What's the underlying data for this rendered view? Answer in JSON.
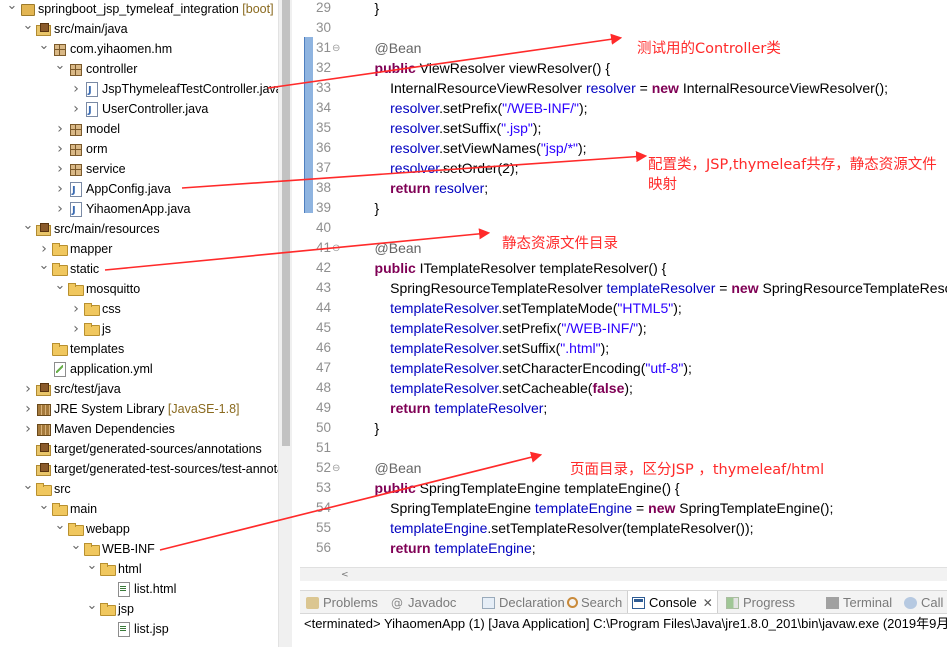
{
  "explorer": {
    "items": [
      {
        "label": "springboot_jsp_tymeleaf_integration",
        "suffix": " [boot]",
        "icon": "project-icon",
        "arrow": "down",
        "depth": 0
      },
      {
        "label": "src/main/java",
        "icon": "source-folder-icon",
        "arrow": "down",
        "depth": 1
      },
      {
        "label": "com.yihaomen.hm",
        "icon": "package-icon",
        "arrow": "down",
        "depth": 2
      },
      {
        "label": "controller",
        "icon": "package-icon",
        "arrow": "down",
        "depth": 3
      },
      {
        "label": "JspThymeleafTestController.java",
        "icon": "java-file-icon",
        "arrow": "right",
        "depth": 4
      },
      {
        "label": "UserController.java",
        "icon": "java-file-icon",
        "arrow": "right",
        "depth": 4
      },
      {
        "label": "model",
        "icon": "package-icon",
        "arrow": "right",
        "depth": 3
      },
      {
        "label": "orm",
        "icon": "package-icon",
        "arrow": "right",
        "depth": 3
      },
      {
        "label": "service",
        "icon": "package-icon",
        "arrow": "right",
        "depth": 3
      },
      {
        "label": "AppConfig.java",
        "icon": "java-file-icon",
        "arrow": "right",
        "depth": 3
      },
      {
        "label": "YihaomenApp.java",
        "icon": "java-file-icon",
        "arrow": "right",
        "depth": 3
      },
      {
        "label": "src/main/resources",
        "icon": "source-folder-icon",
        "arrow": "down",
        "depth": 1
      },
      {
        "label": "mapper",
        "icon": "folder-icon",
        "arrow": "right",
        "depth": 2
      },
      {
        "label": "static",
        "icon": "folder-icon",
        "arrow": "down",
        "depth": 2
      },
      {
        "label": "mosquitto",
        "icon": "folder-icon",
        "arrow": "down",
        "depth": 3
      },
      {
        "label": "css",
        "icon": "folder-icon",
        "arrow": "right",
        "depth": 4
      },
      {
        "label": "js",
        "icon": "folder-icon",
        "arrow": "right",
        "depth": 4
      },
      {
        "label": "templates",
        "icon": "folder-icon",
        "arrow": "none",
        "depth": 2
      },
      {
        "label": "application.yml",
        "icon": "yml-file-icon",
        "arrow": "none",
        "depth": 2
      },
      {
        "label": "src/test/java",
        "icon": "source-folder-icon",
        "arrow": "right",
        "depth": 1
      },
      {
        "label": "JRE System Library",
        "suffix": " [JavaSE-1.8]",
        "icon": "library-icon",
        "arrow": "right",
        "depth": 1
      },
      {
        "label": "Maven Dependencies",
        "icon": "library-icon",
        "arrow": "right",
        "depth": 1
      },
      {
        "label": "target/generated-sources/annotations",
        "icon": "source-folder-icon",
        "arrow": "none",
        "depth": 1
      },
      {
        "label": "target/generated-test-sources/test-annotations",
        "icon": "source-folder-icon",
        "arrow": "none",
        "depth": 1
      },
      {
        "label": "src",
        "icon": "folder-icon",
        "arrow": "down",
        "depth": 1
      },
      {
        "label": "main",
        "icon": "folder-icon",
        "arrow": "down",
        "depth": 2
      },
      {
        "label": "webapp",
        "icon": "folder-icon",
        "arrow": "down",
        "depth": 3
      },
      {
        "label": "WEB-INF",
        "icon": "folder-icon",
        "arrow": "down",
        "depth": 4
      },
      {
        "label": "html",
        "icon": "folder-icon",
        "arrow": "down",
        "depth": 5
      },
      {
        "label": "list.html",
        "icon": "html-file-icon",
        "arrow": "none",
        "depth": 6
      },
      {
        "label": "jsp",
        "icon": "folder-icon",
        "arrow": "down",
        "depth": 5
      },
      {
        "label": "list.jsp",
        "icon": "html-file-icon",
        "arrow": "none",
        "depth": 6
      }
    ]
  },
  "editor": {
    "lines": [
      {
        "n": "29",
        "fold": "",
        "t": [
          [
            "p",
            "    }"
          ]
        ]
      },
      {
        "n": "30",
        "fold": "",
        "t": []
      },
      {
        "n": "31",
        "fold": "⊖",
        "t": [
          [
            "a",
            "    @Bean"
          ]
        ]
      },
      {
        "n": "32",
        "fold": "",
        "t": [
          [
            "k",
            "    public "
          ],
          [
            "p",
            "ViewResolver viewResolver() {"
          ]
        ]
      },
      {
        "n": "33",
        "fold": "",
        "t": [
          [
            "p",
            "        InternalResourceViewResolver "
          ],
          [
            "v",
            "resolver"
          ],
          [
            "p",
            " = "
          ],
          [
            "k",
            "new "
          ],
          [
            "p",
            "InternalResourceViewResolver();"
          ]
        ]
      },
      {
        "n": "34",
        "fold": "",
        "t": [
          [
            "v",
            "        resolver"
          ],
          [
            "p",
            ".setPrefix("
          ],
          [
            "s",
            "\"/WEB-INF/\""
          ],
          [
            "p",
            ");"
          ]
        ]
      },
      {
        "n": "35",
        "fold": "",
        "t": [
          [
            "v",
            "        resolver"
          ],
          [
            "p",
            ".setSuffix("
          ],
          [
            "s",
            "\".jsp\""
          ],
          [
            "p",
            ");"
          ]
        ]
      },
      {
        "n": "36",
        "fold": "",
        "t": [
          [
            "v",
            "        resolver"
          ],
          [
            "p",
            ".setViewNames("
          ],
          [
            "s",
            "\"jsp/*\""
          ],
          [
            "p",
            ");"
          ]
        ]
      },
      {
        "n": "37",
        "fold": "",
        "t": [
          [
            "v",
            "        resolver"
          ],
          [
            "p",
            ".setOrder(2);"
          ]
        ]
      },
      {
        "n": "38",
        "fold": "",
        "t": [
          [
            "k",
            "        return "
          ],
          [
            "v",
            "resolver"
          ],
          [
            "p",
            ";"
          ]
        ]
      },
      {
        "n": "39",
        "fold": "",
        "t": [
          [
            "p",
            "    }"
          ]
        ]
      },
      {
        "n": "40",
        "fold": "",
        "t": []
      },
      {
        "n": "41",
        "fold": "⊖",
        "t": [
          [
            "a",
            "    @Bean"
          ]
        ]
      },
      {
        "n": "42",
        "fold": "",
        "t": [
          [
            "k",
            "    public "
          ],
          [
            "p",
            "ITemplateResolver templateResolver() {"
          ]
        ]
      },
      {
        "n": "43",
        "fold": "",
        "t": [
          [
            "p",
            "        SpringResourceTemplateResolver "
          ],
          [
            "v",
            "templateResolver"
          ],
          [
            "p",
            " = "
          ],
          [
            "k",
            "new "
          ],
          [
            "p",
            "SpringResourceTemplateResolver();"
          ]
        ]
      },
      {
        "n": "44",
        "fold": "",
        "t": [
          [
            "v",
            "        templateResolver"
          ],
          [
            "p",
            ".setTemplateMode("
          ],
          [
            "s",
            "\"HTML5\""
          ],
          [
            "p",
            ");"
          ]
        ]
      },
      {
        "n": "45",
        "fold": "",
        "t": [
          [
            "v",
            "        templateResolver"
          ],
          [
            "p",
            ".setPrefix("
          ],
          [
            "s",
            "\"/WEB-INF/\""
          ],
          [
            "p",
            ");"
          ]
        ]
      },
      {
        "n": "46",
        "fold": "",
        "t": [
          [
            "v",
            "        templateResolver"
          ],
          [
            "p",
            ".setSuffix("
          ],
          [
            "s",
            "\".html\""
          ],
          [
            "p",
            ");"
          ]
        ]
      },
      {
        "n": "47",
        "fold": "",
        "t": [
          [
            "v",
            "        templateResolver"
          ],
          [
            "p",
            ".setCharacterEncoding("
          ],
          [
            "s",
            "\"utf-8\""
          ],
          [
            "p",
            ");"
          ]
        ]
      },
      {
        "n": "48",
        "fold": "",
        "t": [
          [
            "v",
            "        templateResolver"
          ],
          [
            "p",
            ".setCacheable("
          ],
          [
            "k",
            "false"
          ],
          [
            "p",
            ");"
          ]
        ]
      },
      {
        "n": "49",
        "fold": "",
        "t": [
          [
            "k",
            "        return "
          ],
          [
            "v",
            "templateResolver"
          ],
          [
            "p",
            ";"
          ]
        ]
      },
      {
        "n": "50",
        "fold": "",
        "t": [
          [
            "p",
            "    }"
          ]
        ]
      },
      {
        "n": "51",
        "fold": "",
        "t": []
      },
      {
        "n": "52",
        "fold": "⊖",
        "t": [
          [
            "a",
            "    @Bean"
          ]
        ]
      },
      {
        "n": "53",
        "fold": "",
        "t": [
          [
            "k",
            "    public "
          ],
          [
            "p",
            "SpringTemplateEngine templateEngine() {"
          ]
        ]
      },
      {
        "n": "54",
        "fold": "",
        "t": [
          [
            "p",
            "        SpringTemplateEngine "
          ],
          [
            "v",
            "templateEngine"
          ],
          [
            "p",
            " = "
          ],
          [
            "k",
            "new "
          ],
          [
            "p",
            "SpringTemplateEngine();"
          ]
        ]
      },
      {
        "n": "55",
        "fold": "",
        "t": [
          [
            "v",
            "        templateEngine"
          ],
          [
            "p",
            ".setTemplateResolver(templateResolver());"
          ]
        ]
      },
      {
        "n": "56",
        "fold": "",
        "t": [
          [
            "k",
            "        return "
          ],
          [
            "v",
            "templateEngine"
          ],
          [
            "p",
            ";"
          ]
        ]
      }
    ]
  },
  "console": {
    "tabs": [
      {
        "label": "Problems",
        "icon": "problems-icon"
      },
      {
        "label": "Javadoc",
        "icon": "javadoc-icon"
      },
      {
        "label": "Declaration",
        "icon": "declaration-icon"
      },
      {
        "label": "Search",
        "icon": "search-icon"
      },
      {
        "label": "Console",
        "icon": "console-icon",
        "active": true
      },
      {
        "label": "Progress",
        "icon": "progress-icon"
      },
      {
        "label": "Terminal",
        "icon": "terminal-icon"
      },
      {
        "label": "Call Hierarchy",
        "icon": "call-hierarchy-icon"
      }
    ],
    "close_glyph": "✕",
    "status": "<terminated> YihaomenApp (1) [Java Application] C:\\Program Files\\Java\\jre1.8.0_201\\bin\\javaw.exe (2019年9月"
  },
  "annotations": {
    "controller_note": "测试用的Controller类",
    "config_note": "配置类，JSP,thymeleaf共存，静态资源文件映射",
    "static_note": "静态资源文件目录",
    "pages_note": "页面目录，区分JSP ，thymeleaf/html",
    "color": "#ff2a2a"
  }
}
